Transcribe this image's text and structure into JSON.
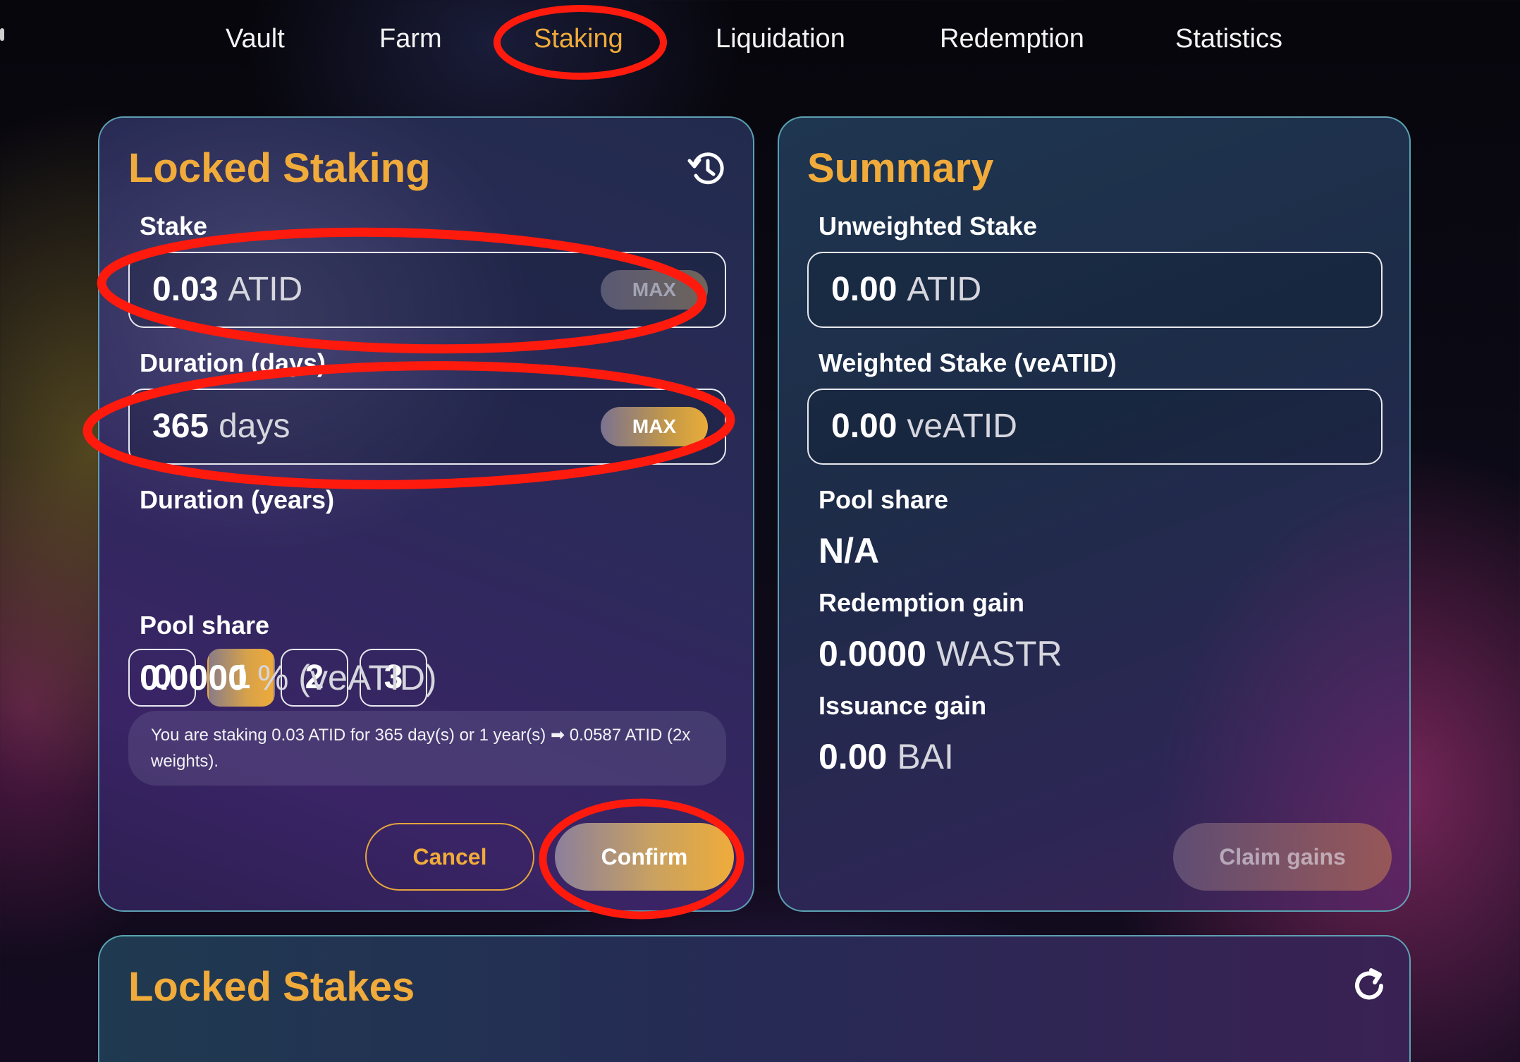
{
  "nav": {
    "items": [
      "Vault",
      "Farm",
      "Staking",
      "Liquidation",
      "Redemption",
      "Statistics"
    ],
    "active": "Staking"
  },
  "locked_staking": {
    "title": "Locked Staking",
    "history_icon": "history-icon",
    "stake": {
      "label": "Stake",
      "value": "0.03",
      "unit": "ATID",
      "max_label": "MAX"
    },
    "duration_days": {
      "label": "Duration (days)",
      "value": "365",
      "unit": "days",
      "max_label": "MAX"
    },
    "duration_years": {
      "label": "Duration (years)",
      "options": [
        "0",
        "1",
        "2",
        "3"
      ],
      "selected": "1"
    },
    "pool_share": {
      "label": "Pool share",
      "value": "0.0000",
      "unit": "% (veATID)"
    },
    "note": "You are staking 0.03 ATID for 365 day(s) or 1 year(s) ➡ 0.0587 ATID (2x weights).",
    "cancel_label": "Cancel",
    "confirm_label": "Confirm"
  },
  "summary": {
    "title": "Summary",
    "unweighted": {
      "label": "Unweighted Stake",
      "value": "0.00",
      "unit": "ATID"
    },
    "weighted": {
      "label": "Weighted Stake (veATID)",
      "value": "0.00",
      "unit": "veATID"
    },
    "pool_share": {
      "label": "Pool share",
      "value": "N/A"
    },
    "redemption_gain": {
      "label": "Redemption gain",
      "value": "0.0000",
      "unit": "WASTR"
    },
    "issuance_gain": {
      "label": "Issuance gain",
      "value": "0.00",
      "unit": "BAI"
    },
    "claim_label": "Claim gains"
  },
  "locked_stakes": {
    "title": "Locked Stakes",
    "refresh_icon": "refresh-icon"
  },
  "colors": {
    "accent": "#f0ab3a",
    "annotation": "#ff1a0e",
    "panel_border": "#6ec8d2"
  }
}
